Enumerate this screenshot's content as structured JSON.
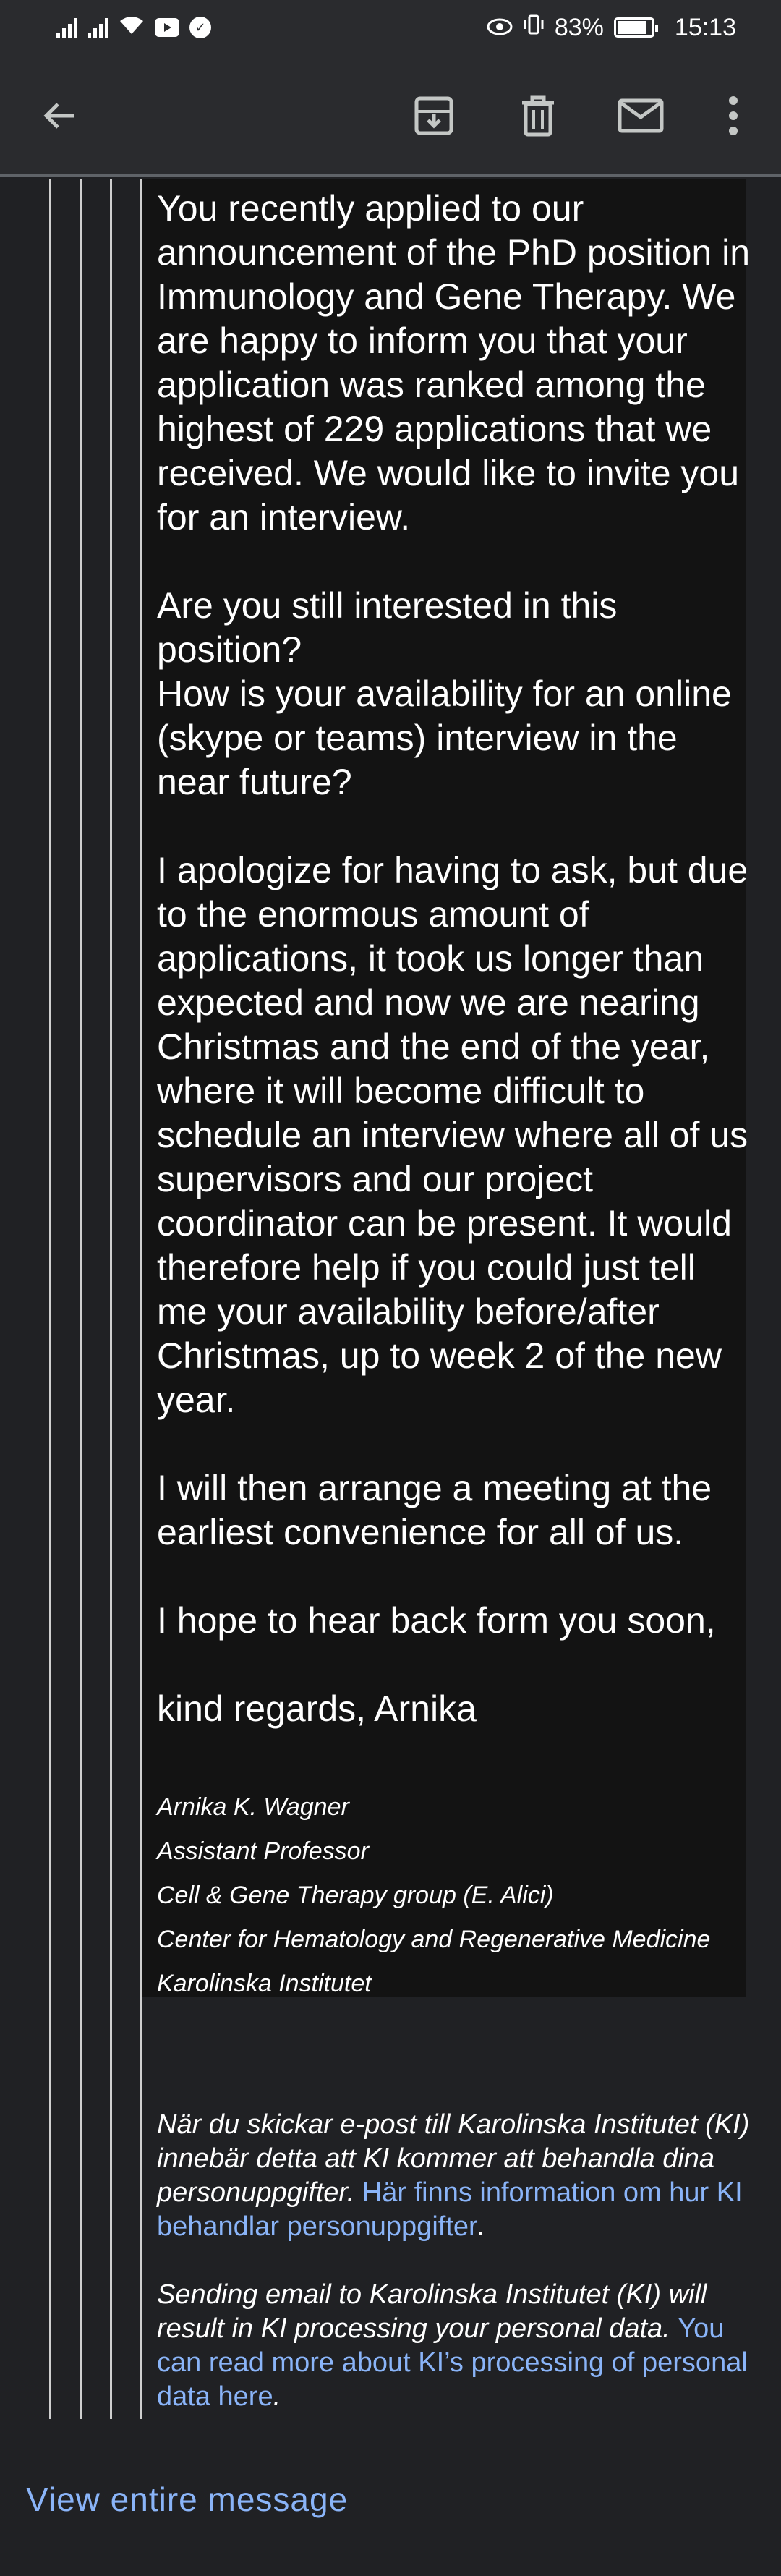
{
  "status_bar": {
    "battery_percent": "83%",
    "time": "15:13"
  },
  "toolbar": {
    "icons": [
      "back-arrow-icon",
      "archive-icon",
      "trash-icon",
      "mail-icon",
      "more-vert-icon"
    ]
  },
  "email": {
    "paragraphs": [
      "You recently applied to our announcement of the PhD position in Immunology and Gene Therapy. We are happy to inform you that your application was ranked among the highest of 229 applications that we received. We would like to invite you for an interview.",
      "Are you still interested in this position?",
      "How is your availability for an online (skype or teams) interview in the near future?",
      "I apologize for having to ask, but due to the enormous amount of applications, it took us longer than expected and now we are nearing Christmas and the end of the year, where it will become difficult to schedule an interview where all of us supervisors and our project coordinator can be present. It would therefore help if you could just tell me your availability before/after Christmas, up to week 2 of the new year.",
      "I will then arrange a meeting at the earliest convenience for all of us.",
      "I hope to hear back form you soon,",
      "kind regards, Arnika"
    ],
    "signature": [
      "Arnika K. Wagner",
      "Assistant Professor",
      "Cell & Gene Therapy group (E. Alici)",
      "Center for Hematology and Regenerative Medicine",
      "Karolinska Institutet"
    ],
    "footer": {
      "swedish_text": "När du skickar e-post till Karolinska Institutet (KI) innebär detta att KI kommer att behandla dina personuppgifter.",
      "swedish_link": "Här finns information om hur KI behandlar personuppgifter",
      "swedish_end": ".",
      "english_text": "Sending email to Karolinska Institutet (KI) will result in KI processing your personal data.",
      "english_link": "You can read more about KI’s processing of personal data here",
      "english_end": "."
    }
  },
  "view_entire_message": "View entire message",
  "colors": {
    "background": "#202124",
    "toolbar": "#2a2b2e",
    "quote_panel": "#131313",
    "link": "#8ab4f8"
  }
}
